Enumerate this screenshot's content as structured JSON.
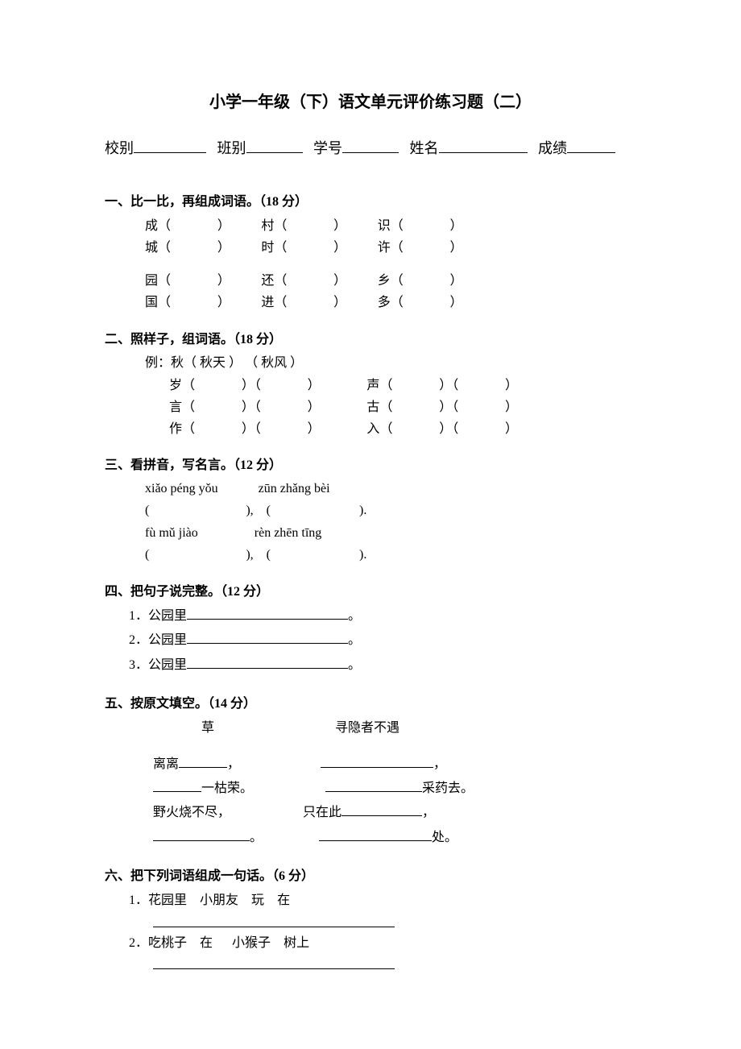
{
  "title": "小学一年级（下）语文单元评价练习题（二）",
  "info": {
    "school_label": "校别",
    "class_label": "班别",
    "number_label": "学号",
    "name_label": "姓名",
    "score_label": "成绩"
  },
  "q1": {
    "heading": "一、比一比，再组成词语。（18 分）",
    "rows": [
      [
        "成",
        "村",
        "识"
      ],
      [
        "城",
        "时",
        "许"
      ],
      [
        "园",
        "还",
        "乡"
      ],
      [
        "国",
        "进",
        "多"
      ]
    ]
  },
  "q2": {
    "heading": "二、照样子，组词语。（18 分）",
    "example_prefix": "例：",
    "example_char": "秋",
    "example_a": "秋天",
    "example_b": "秋风",
    "rows": [
      [
        "岁",
        "声"
      ],
      [
        "言",
        "古"
      ],
      [
        "作",
        "入"
      ]
    ]
  },
  "q3": {
    "heading": "三、看拼音，写名言。（12 分）",
    "line1_a": "xiǎo  péng  yǒu",
    "line1_b": "zūn  zhǎng  bèi",
    "line2_a": "fù  mǔ  jiào",
    "line2_b": "rèn  zhēn  tīng"
  },
  "q4": {
    "heading": "四、把句子说完整。（12 分）",
    "items": [
      "1．公园里",
      "2．公园里",
      "3．公园里"
    ]
  },
  "q5": {
    "heading": "五、按原文填空。（14 分）",
    "title_a": "草",
    "title_b": "寻隐者不遇",
    "left_1_pre": "离离",
    "left_2_suf": "一枯荣。",
    "left_3": "野火烧不尽，",
    "right_2_suf": "采药去。",
    "right_3_pre": "只在此",
    "right_4_suf": "处。"
  },
  "q6": {
    "heading": "六、把下列词语组成一句话。（6 分）",
    "item1_prefix": "1．",
    "item1_words": [
      "花园里",
      "小朋友",
      "玩",
      "在"
    ],
    "item2_prefix": "2．",
    "item2_words": [
      "吃桃子",
      "在",
      "小猴子",
      "树上"
    ]
  }
}
